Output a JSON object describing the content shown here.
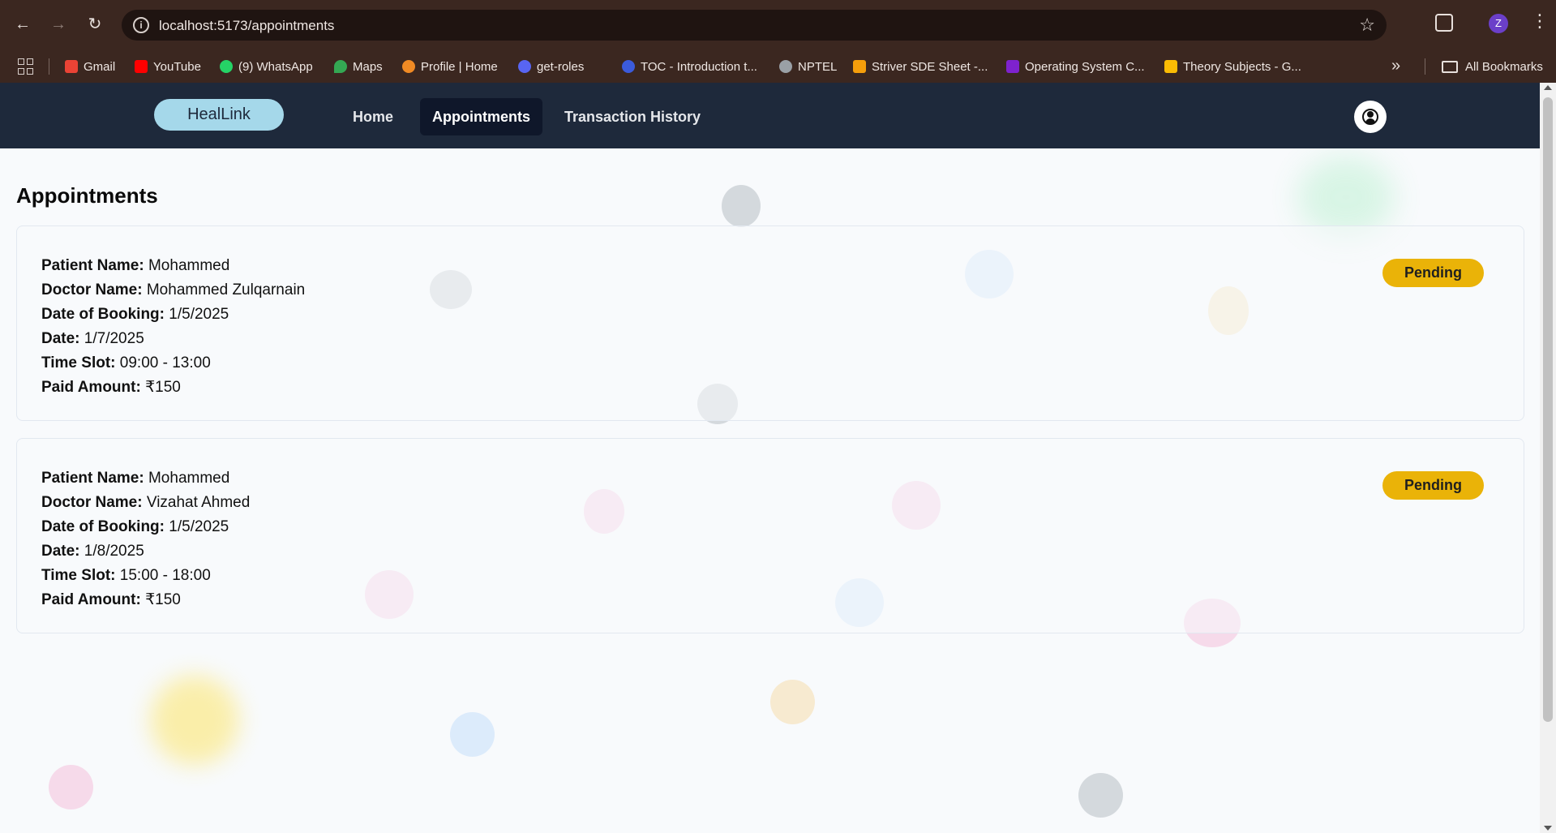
{
  "browser": {
    "url": "localhost:5173/appointments",
    "bookmarks": [
      {
        "label": "Gmail",
        "color": "#ea4335"
      },
      {
        "label": "YouTube",
        "color": "#ff0000"
      },
      {
        "label": "(9) WhatsApp",
        "color": "#25d366"
      },
      {
        "label": "Maps",
        "color": "#34a853"
      },
      {
        "label": "Profile | Home",
        "color": "#f08a24"
      },
      {
        "label": "get-roles",
        "color": "#5865f2"
      },
      {
        "label": "TOC - Introduction t...",
        "color": "#3b5bdb"
      },
      {
        "label": "NPTEL",
        "color": "#9aa0a6"
      },
      {
        "label": "Striver SDE Sheet -...",
        "color": "#f59e0b"
      },
      {
        "label": "Operating System C...",
        "color": "#7e22ce"
      },
      {
        "label": "Theory Subjects - G...",
        "color": "#fbbc04"
      }
    ],
    "all_bookmarks": "All Bookmarks",
    "profile_initial": "Z"
  },
  "app": {
    "logo": "HealLink",
    "nav": [
      "Home",
      "Appointments",
      "Transaction History"
    ],
    "active_nav": "Appointments"
  },
  "page": {
    "title": "Appointments",
    "labels": {
      "patient": "Patient Name:",
      "doctor": "Doctor Name:",
      "booking": "Date of Booking:",
      "date": "Date:",
      "slot": "Time Slot:",
      "amount": "Paid Amount:"
    },
    "appointments": [
      {
        "patient": "Mohammed",
        "doctor": "Mohammed Zulqarnain",
        "booking_date": "1/5/2025",
        "date": "1/7/2025",
        "time_slot": "09:00 - 13:00",
        "amount": "₹150",
        "status": "Pending"
      },
      {
        "patient": "Mohammed",
        "doctor": "Vizahat Ahmed",
        "booking_date": "1/5/2025",
        "date": "1/8/2025",
        "time_slot": "15:00 - 18:00",
        "amount": "₹150",
        "status": "Pending"
      }
    ]
  },
  "colors": {
    "nav_bg": "#1e293b",
    "logo_bg": "#a5d8ea",
    "status_pending": "#eab308"
  }
}
